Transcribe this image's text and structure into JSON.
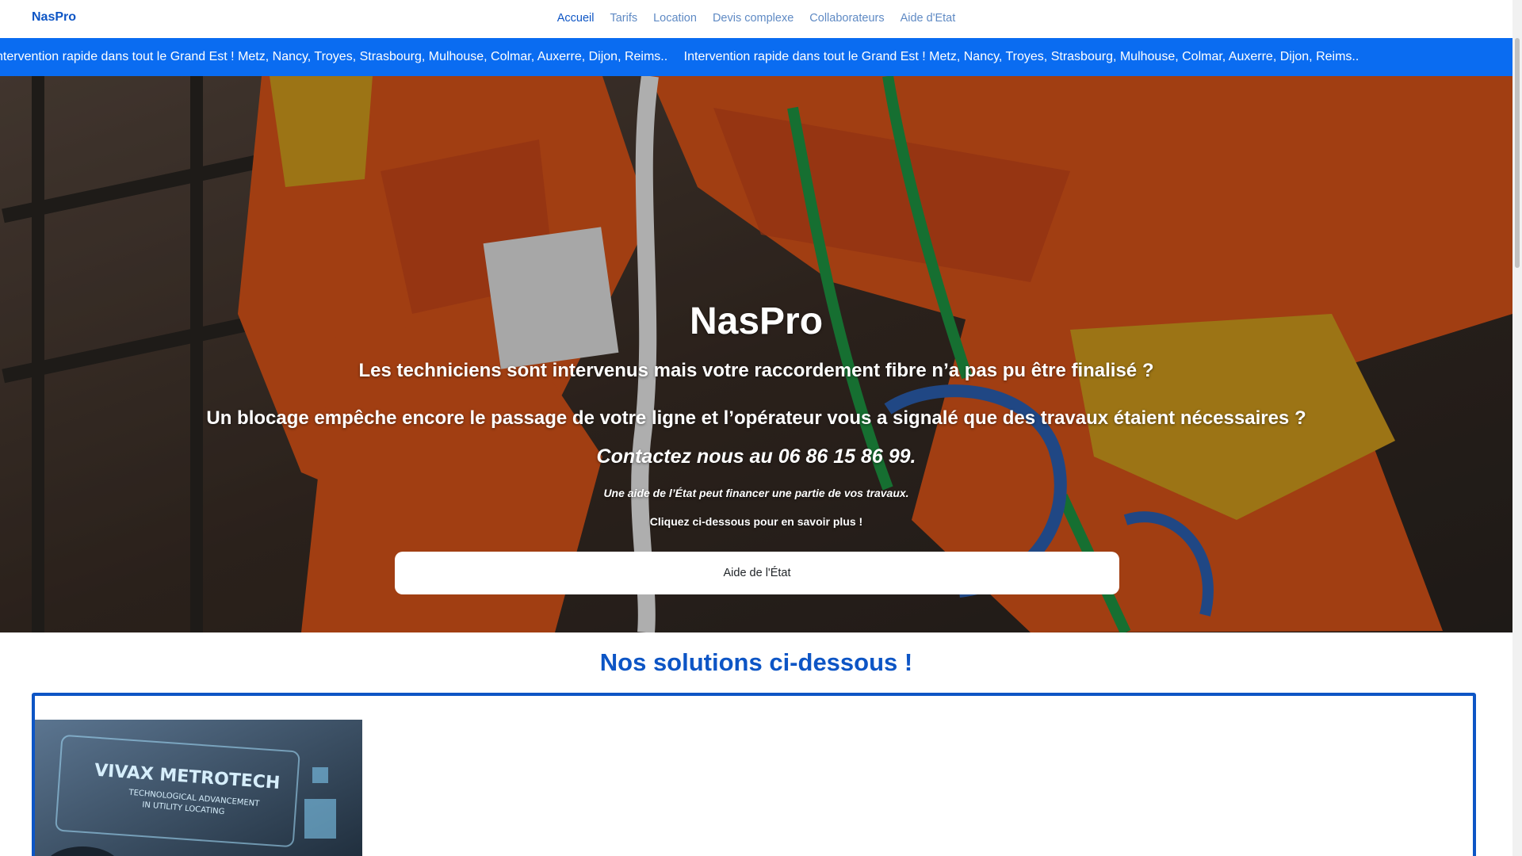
{
  "nav": {
    "brand": "NasPro",
    "links": [
      "Accueil",
      "Tarifs",
      "Location",
      "Devis complexe",
      "Collaborateurs",
      "Aide d'Etat"
    ]
  },
  "ticker": {
    "text": "Intervention rapide dans tout le Grand Est ! Metz, Nancy, Troyes, Strasbourg, Mulhouse, Colmar, Auxerre, Dijon, Reims..",
    "text_cut": "ntervention rapide dans tout le Grand Est ! Metz, Nancy, Troyes, Strasbourg, Mulhouse, Colmar, Auxerre, Dijon, Reims.."
  },
  "hero": {
    "title": "NasPro",
    "line1": "Les techniciens sont intervenus mais votre raccordement fibre n’a pas pu être finalisé ?",
    "line2": "Un blocage empêche encore le passage de votre ligne et l’opérateur vous a signalé que des travaux étaient nécessaires ?",
    "contact": "Contactez nous au 06 86 15 86 99.",
    "aid_note": "Une aide de l’État peut financer une partie de vos travaux.",
    "click_note": "Cliquez ci-dessous pour en savoir plus !",
    "button": "Aide de l'État"
  },
  "solutions": {
    "title": "Nos solutions ci-dessous !",
    "image_text": {
      "brand": "VIVAX METROTECH",
      "tagline1": "TECHNOLOGICAL ADVANCEMENT",
      "tagline2": "IN UTILITY LOCATING"
    }
  },
  "colors": {
    "primary": "#0d55c5",
    "ticker_bg": "#0a6cf1",
    "nav_link": "#5f8ac4"
  }
}
